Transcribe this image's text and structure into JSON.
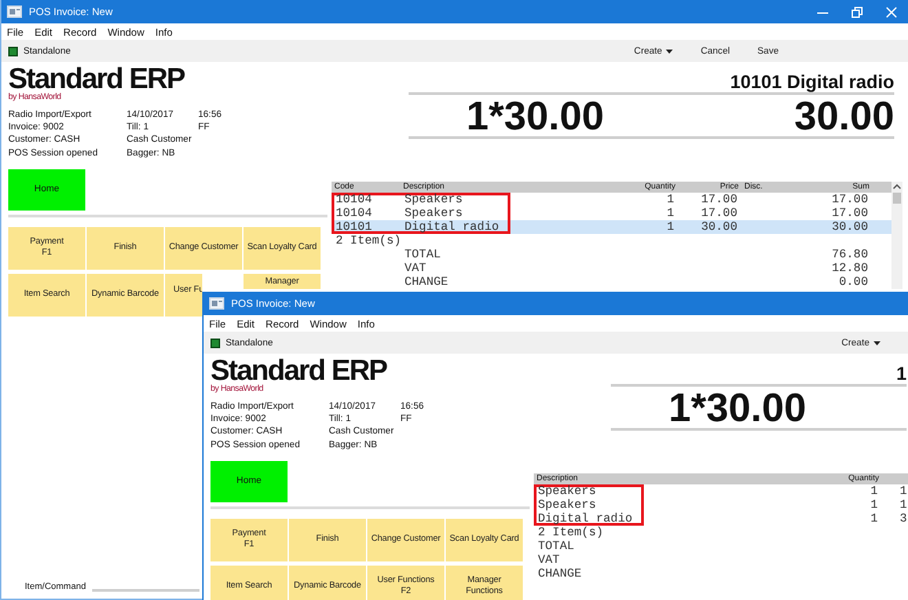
{
  "windows": [
    {
      "title": "POS Invoice: New",
      "window_controls": true,
      "menu": [
        "File",
        "Edit",
        "Record",
        "Window",
        "Info"
      ],
      "status": "Standalone",
      "toolbar": [
        {
          "label": "Create",
          "dropdown": true
        },
        {
          "label": "Cancel",
          "dropdown": false
        },
        {
          "label": "Save",
          "dropdown": false
        }
      ],
      "logo": {
        "name": "Standard ERP",
        "byline": "by HansaWorld"
      },
      "info": [
        [
          "Radio Import/Export",
          "14/10/2017",
          "16:56"
        ],
        [
          "Invoice: 9002",
          "Till: 1",
          "FF"
        ],
        [
          "Customer: CASH",
          "Cash Customer"
        ],
        [
          "POS Session opened",
          "Bagger: NB"
        ]
      ],
      "display": {
        "item": "10101 Digital radio",
        "quantity_price": "1*30.00",
        "amount": "30.00"
      },
      "home_button": "Home",
      "function_buttons": [
        {
          "label": "Payment\nF1"
        },
        {
          "label": "Finish"
        },
        {
          "label": "Change Customer"
        },
        {
          "label": "Scan Loyalty Card"
        },
        {
          "label": "Item Search"
        },
        {
          "label": "Dynamic Barcode"
        },
        {
          "label": "User Fu",
          "cut_right": true
        },
        {
          "label": "Manager",
          "cut_bottom": true
        }
      ],
      "table": {
        "columns": [
          {
            "label": "Code",
            "kind": "text",
            "outlined": true
          },
          {
            "label": "Description",
            "kind": "text",
            "outlined": true
          },
          {
            "label": "Quantity",
            "kind": "number",
            "outlined": false
          },
          {
            "label": "Price",
            "kind": "number",
            "outlined": false
          },
          {
            "label": "Disc.",
            "kind": "text",
            "outlined": false
          },
          {
            "label": "Sum",
            "kind": "number",
            "outlined": false
          }
        ],
        "rows": [
          {
            "cells": [
              "10104",
              "Speakers",
              "1",
              "17.00",
              null,
              "17.00"
            ],
            "selected": false,
            "outlined": true
          },
          {
            "cells": [
              "10104",
              "Speakers",
              "1",
              "17.00",
              null,
              "17.00"
            ],
            "selected": false,
            "outlined": true
          },
          {
            "cells": [
              "10101",
              "Digital radio",
              "1",
              "30.00",
              null,
              "30.00"
            ],
            "selected": true,
            "outlined": true
          }
        ],
        "summary": [
          {
            "label": "2 Item(s)",
            "indented": false
          },
          {
            "label": "TOTAL",
            "value": "76.80",
            "indented": true
          },
          {
            "label": "VAT",
            "value": "12.80",
            "indented": true
          },
          {
            "label": "CHANGE",
            "value": "0.00",
            "indented": true
          }
        ],
        "scrollbar": true
      },
      "command": {
        "label": "Item/Command"
      }
    },
    {
      "title": "POS Invoice: New",
      "menu": [
        "File",
        "Edit",
        "Record",
        "Window",
        "Info"
      ],
      "status": "Standalone",
      "toolbar": [
        {
          "label": "Create",
          "dropdown": true
        }
      ],
      "logo": {
        "name": "Standard ERP",
        "byline": "by HansaWorld"
      },
      "info": [
        [
          "Radio Import/Export",
          "14/10/2017",
          "16:56"
        ],
        [
          "Invoice: 9002",
          "Till: 1",
          "FF"
        ],
        [
          "Customer: CASH",
          "Cash Customer"
        ],
        [
          "POS Session opened",
          "Bagger: NB"
        ]
      ],
      "display": {
        "item": "1",
        "quantity_price": "1*30.00"
      },
      "home_button": "Home",
      "function_buttons": [
        {
          "label": "Payment\nF1"
        },
        {
          "label": "Finish"
        },
        {
          "label": "Change Customer"
        },
        {
          "label": "Scan Loyalty Card"
        },
        {
          "label": "Item Search"
        },
        {
          "label": "Dynamic Barcode"
        },
        {
          "label": "User Functions\nF2"
        },
        {
          "label": "Manager\nFunctions"
        }
      ],
      "table": {
        "columns": [
          {
            "label": "Description",
            "kind": "text",
            "outlined": true
          },
          {
            "label": "Quantity",
            "kind": "number",
            "outlined": false
          },
          {
            "kind": "text",
            "outlined": false
          }
        ],
        "rows": [
          {
            "cells": [
              "Speakers",
              "1",
              "1"
            ],
            "selected": false,
            "outlined": true
          },
          {
            "cells": [
              "Speakers",
              "1",
              "1"
            ],
            "selected": false,
            "outlined": true
          },
          {
            "cells": [
              "Digital radio",
              "1",
              "3"
            ],
            "selected": false,
            "outlined": true
          }
        ],
        "summary": [
          {
            "label": "2 Item(s)",
            "indented": false
          },
          {
            "label": "TOTAL",
            "indented": false
          },
          {
            "label": "VAT",
            "indented": false
          },
          {
            "label": "CHANGE",
            "indented": false
          }
        ]
      }
    }
  ]
}
